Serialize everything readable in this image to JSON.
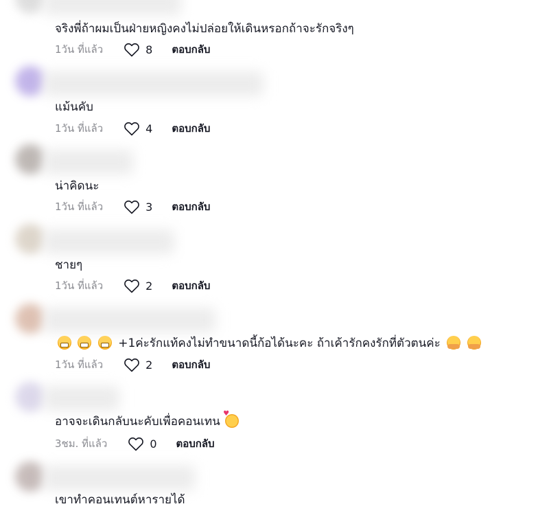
{
  "comments": [
    {
      "text": "จริงพี่ถ้าผมเป็นฝ่ายหญิงคงไม่ปล่อยให้เดินหรอกถ้าจะรักจริงๆ",
      "time": "1วัน ที่แล้ว",
      "likes": "8",
      "reply": "ตอบกลับ",
      "avatar_color": "#d9d9d9"
    },
    {
      "text": "แม้นคับ",
      "time": "1วัน ที่แล้ว",
      "likes": "4",
      "reply": "ตอบกลับ",
      "avatar_color": "#b8a8e6"
    },
    {
      "text": "น่าคิดนะ",
      "time": "1วัน ที่แล้ว",
      "likes": "3",
      "reply": "ตอบกลับ",
      "avatar_color": "#b3aca8"
    },
    {
      "text": "ชายๆ",
      "time": "1วัน ที่แล้ว",
      "likes": "2",
      "reply": "ตอบกลับ",
      "avatar_color": "#d8cfc2"
    },
    {
      "text": "+1ค่ะรักแท้คงไม่ทำขนาดนี้ก้อได้นะคะ ถ้าเค้ารักคงรักที่ตัวตนค่ะ",
      "time": "1วัน ที่แล้ว",
      "likes": "2",
      "reply": "ตอบกลับ",
      "avatar_color": "#d9b7a6"
    },
    {
      "text": "อาจจะเดินกลับนะคับเพื่อคอนเทน",
      "time": "3ชม. ที่แล้ว",
      "likes": "0",
      "reply": "ตอบกลับ",
      "avatar_color": "#d7d2e8"
    },
    {
      "text": "เขาทำคอนเทนต์หารายได้",
      "avatar_color": "#bdb0ae"
    }
  ]
}
